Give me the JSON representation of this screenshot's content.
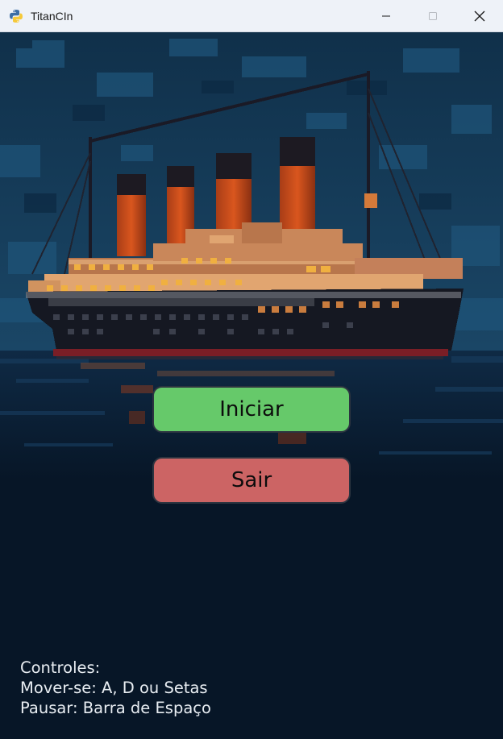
{
  "window": {
    "title": "TitanCIn",
    "icon": "python-logo-icon"
  },
  "title_bar_buttons": {
    "minimize_icon": "minimize-icon",
    "maximize_icon": "maximize-icon",
    "close_icon": "close-icon"
  },
  "scene": {
    "description_icon": "titanic-ship-pixel-art",
    "sky_color": "#153954",
    "sea_color": "#0b2036",
    "background_color": "#071627"
  },
  "menu": {
    "start_label": "Iniciar",
    "start_color": "#66c96a",
    "quit_label": "Sair",
    "quit_color": "#cc6464"
  },
  "controls": {
    "heading": "Controles:",
    "move": "Mover-se: A, D ou Setas",
    "pause": "Pausar: Barra de Espaço"
  }
}
